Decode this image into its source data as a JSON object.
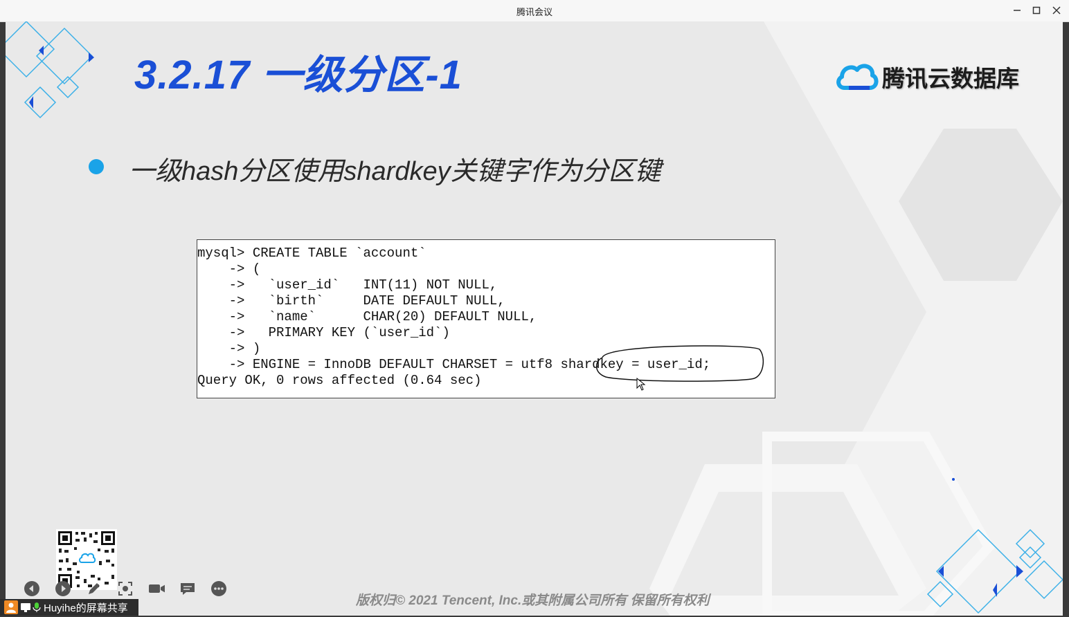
{
  "window": {
    "title": "腾讯会议",
    "minimize_icon": "minimize-icon",
    "maximize_icon": "maximize-icon",
    "close_icon": "close-icon"
  },
  "slide": {
    "title": "3.2.17 一级分区-1",
    "logo_text": "腾讯云数据库",
    "bullet": "一级hash分区使用shardkey关键字作为分区键",
    "code_lines": [
      "mysql> CREATE TABLE `account`",
      "    -> (",
      "    ->   `user_id`   INT(11) NOT NULL,",
      "    ->   `birth`     DATE DEFAULT NULL,",
      "    ->   `name`      CHAR(20) DEFAULT NULL,",
      "    ->   PRIMARY KEY (`user_id`)",
      "    -> )",
      "    -> ENGINE = InnoDB DEFAULT CHARSET = utf8 shardkey = user_id;",
      "Query OK, 0 rows affected (0.64 sec)"
    ],
    "copyright": "版权归© 2021 Tencent, Inc.或其附属公司所有 保留所有权利",
    "colors": {
      "title": "#1a4fd6",
      "bullet": "#1aa3e8",
      "background": "#e9e9e9"
    }
  },
  "meeting_toolbar": {
    "icons": [
      "prev-icon",
      "next-icon",
      "pen-icon",
      "screenshot-icon",
      "camera-icon",
      "chat-icon",
      "more-icon"
    ]
  },
  "share_bar": {
    "label": "Huyihe的屏幕共享"
  }
}
